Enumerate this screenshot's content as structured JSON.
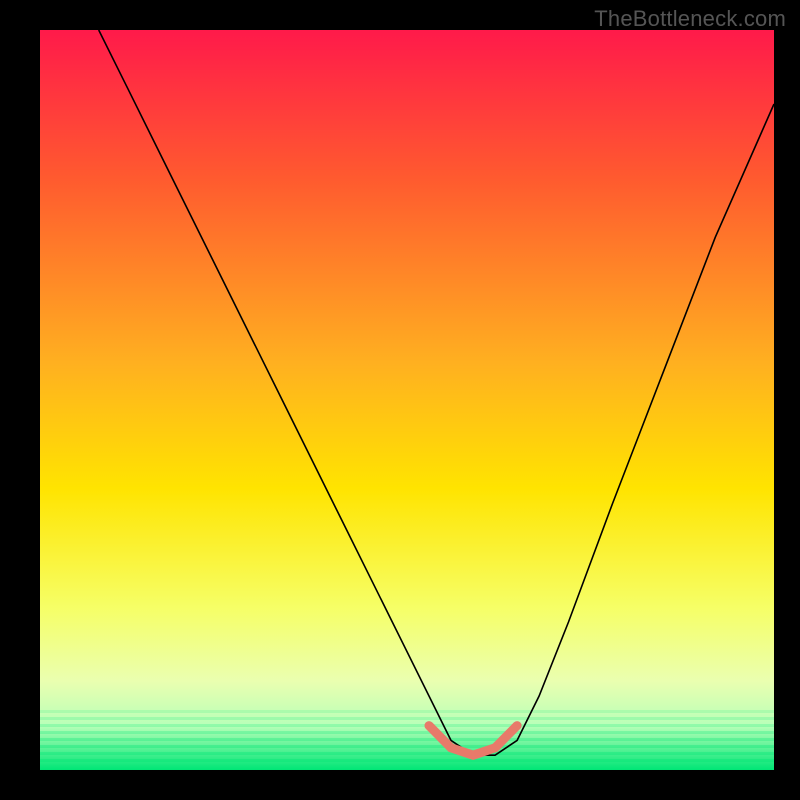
{
  "watermark": "TheBottleneck.com",
  "chart_data": {
    "type": "line",
    "title": "",
    "xlabel": "",
    "ylabel": "",
    "xlim": [
      0,
      100
    ],
    "ylim": [
      0,
      100
    ],
    "grid": false,
    "legend": false,
    "background_gradient": {
      "stops": [
        {
          "offset": 0.0,
          "color": "#ff1a4a"
        },
        {
          "offset": 0.2,
          "color": "#ff5a2f"
        },
        {
          "offset": 0.45,
          "color": "#ffb020"
        },
        {
          "offset": 0.62,
          "color": "#ffe400"
        },
        {
          "offset": 0.78,
          "color": "#f6ff66"
        },
        {
          "offset": 0.88,
          "color": "#eaffb0"
        },
        {
          "offset": 0.94,
          "color": "#b8ffb8"
        },
        {
          "offset": 1.0,
          "color": "#00e676"
        }
      ]
    },
    "series": [
      {
        "name": "bottleneck-curve",
        "x": [
          8,
          12,
          18,
          25,
          33,
          41,
          48,
          53,
          56,
          59,
          62,
          65,
          68,
          72,
          78,
          85,
          92,
          100
        ],
        "y": [
          100,
          92,
          80,
          66,
          50,
          34,
          20,
          10,
          4,
          2,
          2,
          4,
          10,
          20,
          36,
          54,
          72,
          90
        ]
      }
    ],
    "highlight": {
      "name": "optimal-zone",
      "x": [
        53,
        56,
        59,
        62,
        65
      ],
      "y": [
        6,
        3,
        2,
        3,
        6
      ],
      "color": "#e87a6a"
    }
  }
}
